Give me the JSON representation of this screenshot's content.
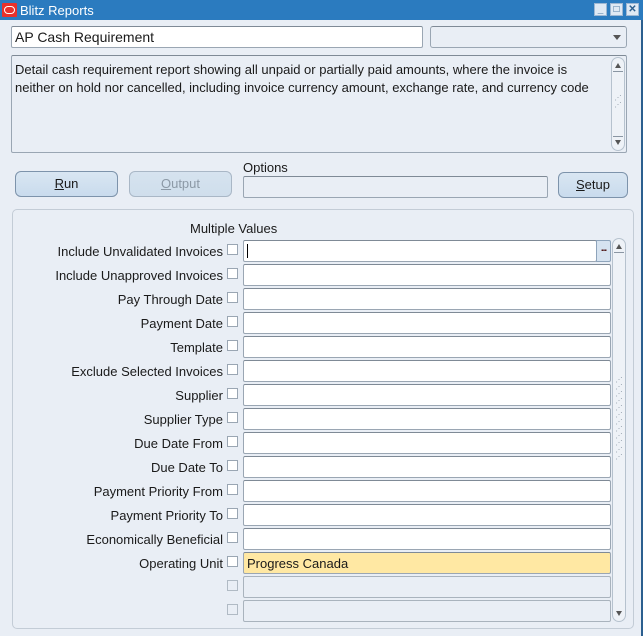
{
  "window": {
    "title": "Blitz Reports",
    "app_icon": "oracle-icon",
    "controls": [
      "minimize-icon",
      "maximize-icon",
      "close-icon"
    ]
  },
  "header": {
    "report_name": "AP Cash Requirement",
    "category_select_value": "",
    "description": "Detail cash requirement report showing all unpaid or partially paid amounts, where the invoice is neither on hold nor cancelled, including invoice currency amount, exchange rate, and currency code"
  },
  "actions": {
    "run_label": "Run",
    "run_mnemonic": "R",
    "output_label": "Output",
    "output_mnemonic": "O",
    "options_label": "Options",
    "options_value": "",
    "setup_label": "Setup",
    "setup_mnemonic": "S"
  },
  "parameters": {
    "multiple_values_header": "Multiple Values",
    "lov_button_label": "...",
    "rows": [
      {
        "label": "Include Unvalidated Invoices",
        "value": "",
        "checked": false
      },
      {
        "label": "Include Unapproved Invoices",
        "value": "",
        "checked": false
      },
      {
        "label": "Pay Through Date",
        "value": "",
        "checked": false
      },
      {
        "label": "Payment Date",
        "value": "",
        "checked": false
      },
      {
        "label": "Template",
        "value": "",
        "checked": false
      },
      {
        "label": "Exclude Selected Invoices",
        "value": "",
        "checked": false
      },
      {
        "label": "Supplier",
        "value": "",
        "checked": false
      },
      {
        "label": "Supplier Type",
        "value": "",
        "checked": false
      },
      {
        "label": "Due Date From",
        "value": "",
        "checked": false
      },
      {
        "label": "Due Date To",
        "value": "",
        "checked": false
      },
      {
        "label": "Payment Priority From",
        "value": "",
        "checked": false
      },
      {
        "label": "Payment Priority To",
        "value": "",
        "checked": false
      },
      {
        "label": "Economically Beneficial",
        "value": "",
        "checked": false
      },
      {
        "label": "Operating Unit",
        "value": "Progress Canada",
        "checked": false
      },
      {
        "label": "",
        "value": "",
        "checked": false
      },
      {
        "label": "",
        "value": "",
        "checked": false
      }
    ]
  },
  "colors": {
    "titlebar": "#2b7bbf",
    "background": "#e9eef5",
    "highlight_field": "#ffe8a3",
    "oracle_red": "#e8312b"
  }
}
